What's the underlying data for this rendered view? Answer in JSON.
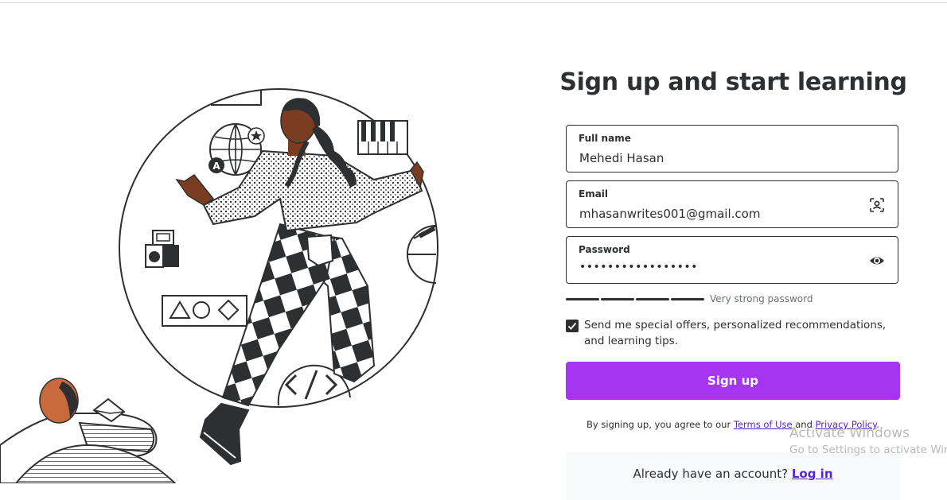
{
  "page": {
    "title": "Sign up and start learning"
  },
  "form": {
    "full_name": {
      "label": "Full name",
      "value": "Mehedi Hasan"
    },
    "email": {
      "label": "Email",
      "value": "mhasanwrites001@gmail.com",
      "icon": "contact-scan-icon"
    },
    "password": {
      "label": "Password",
      "value": "•••••••••••••••••",
      "icon": "eye-icon"
    },
    "strength": {
      "level_fraction": 1.0,
      "text": "Very strong password"
    },
    "offers": {
      "checked": true,
      "label": "Send me special offers, personalized recommendations, and learning tips."
    },
    "submit_label": "Sign up"
  },
  "terms": {
    "prefix": "By signing up, you agree to our ",
    "terms_link": "Terms of Use",
    "and": " and ",
    "privacy_link": "Privacy Policy",
    "suffix": "."
  },
  "login": {
    "prompt": "Already have an account? ",
    "link": "Log in"
  },
  "watermark": {
    "title": "Activate Windows",
    "subtitle": "Go to Settings to activate Windows."
  },
  "colors": {
    "accent": "#a435f0",
    "link": "#5624d0",
    "text": "#2d2f31",
    "skin": "#7a3d21",
    "hair": "#c96a3c"
  }
}
